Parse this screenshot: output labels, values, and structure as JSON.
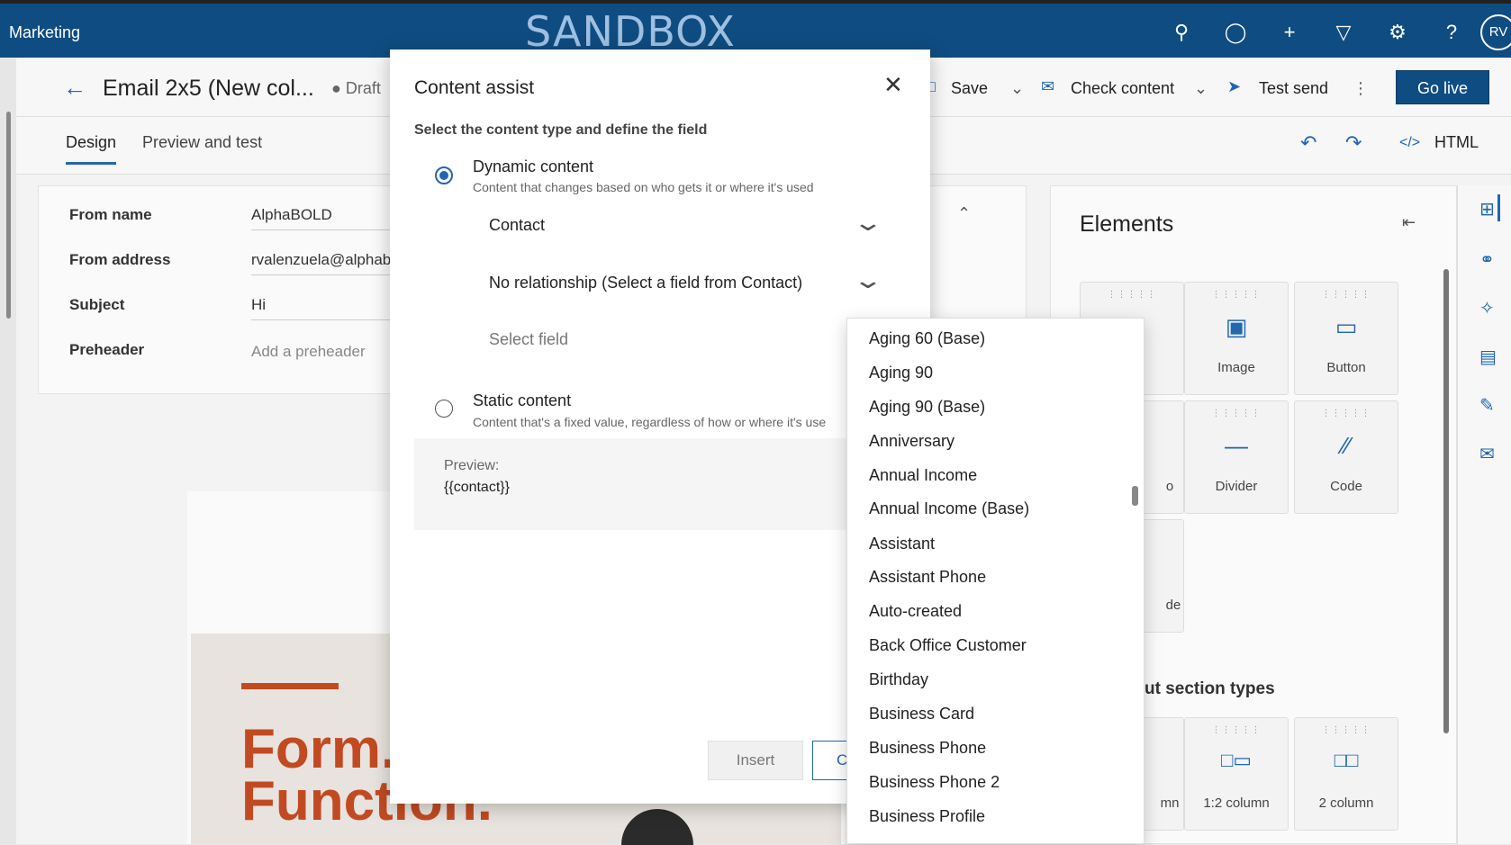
{
  "topbar": {
    "app_name": "Marketing",
    "environment": "SANDBOX",
    "avatar_initials": "RV"
  },
  "commandbar": {
    "title": "Email 2x5 (New col...",
    "status": "Draft",
    "save": "Save",
    "check_content": "Check content",
    "test_send": "Test send",
    "go_live": "Go live"
  },
  "tabs": {
    "design": "Design",
    "preview": "Preview and test",
    "html": "HTML"
  },
  "email_form": {
    "from_name_label": "From name",
    "from_name_value": "AlphaBOLD",
    "from_address_label": "From address",
    "from_address_value": "rvalenzuela@alphab",
    "subject_label": "Subject",
    "subject_value": "Hi",
    "preheader_label": "Preheader",
    "preheader_placeholder": "Add a preheader"
  },
  "email_canvas": {
    "hero_text_line1": "Form.",
    "hero_text_line2": "Function."
  },
  "elements_panel": {
    "title": "Elements",
    "cards": [
      {
        "label": "Image",
        "icon": "image-icon"
      },
      {
        "label": "Button",
        "icon": "button-icon"
      },
      {
        "label": "o",
        "icon": "video-icon"
      },
      {
        "label": "Divider",
        "icon": "divider-icon"
      },
      {
        "label": "Code",
        "icon": "code-icon"
      },
      {
        "label": "de",
        "icon": "element-icon"
      }
    ],
    "section_types_label": "ut section types",
    "section_cards": [
      {
        "label": "mn"
      },
      {
        "label": "1:2 column"
      },
      {
        "label": "2 column"
      }
    ]
  },
  "modal": {
    "title": "Content assist",
    "subtitle": "Select the content type and define the field",
    "dynamic_title": "Dynamic content",
    "dynamic_desc": "Content that changes based on who gets it or where it's used",
    "entity_value": "Contact",
    "relationship_value": "No relationship (Select a field from Contact)",
    "field_placeholder": "Select field",
    "static_title": "Static content",
    "static_desc": "Content that's a fixed value, regardless of how or where it's use",
    "preview_label": "Preview:",
    "preview_value": "{{contact}}",
    "insert_label": "Insert",
    "cancel_label": "C"
  },
  "field_list": {
    "items": [
      "Aging 60 (Base)",
      "Aging 90",
      "Aging 90 (Base)",
      "Anniversary",
      "Annual Income",
      "Annual Income (Base)",
      "Assistant",
      "Assistant Phone",
      "Auto-created",
      "Back Office Customer",
      "Birthday",
      "Business Card",
      "Business Phone",
      "Business Phone 2",
      "Business Profile"
    ]
  },
  "colors": {
    "brand_bar": "#0f4c81",
    "accent": "#2266b0",
    "hero_text": "#c24a22"
  }
}
